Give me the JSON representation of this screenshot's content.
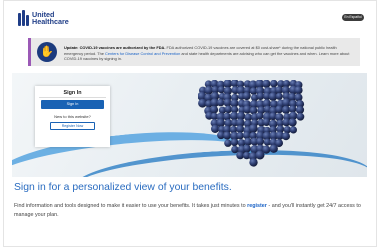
{
  "header": {
    "brand_line1": "United",
    "brand_line2": "Healthcare",
    "language_button": "En Español",
    "brand_color": "#1f3d87"
  },
  "alert": {
    "icon": "hand-stop-icon",
    "bold": "Update: COVID-19 vaccines are authorized by the FDA.",
    "text1": " FDA authorized COVID-19 vaccines are covered at $0 cost-share* during the national public health emergency period. The ",
    "link": "Centers for Disease Control and Prevention",
    "text2": " and state health departments are advising who can get the vaccines and when. Learn more about COVID-19 vaccines by signing in."
  },
  "signin": {
    "title": "Sign In",
    "signin_button": "Sign In",
    "new_prompt": "New to this website?",
    "register_button": "Register Now"
  },
  "main": {
    "headline": "Sign in for a personalized view of your benefits.",
    "copy_before": "Find information and tools designed to make it easier to use your benefits. It takes just minutes to ",
    "copy_link": "register",
    "copy_after": " - and you'll instantly get 24/7 access to manage your plan."
  },
  "colors": {
    "accent": "#2a6cc0",
    "button_blue": "#1962b4",
    "alert_border": "#9b59b6"
  }
}
